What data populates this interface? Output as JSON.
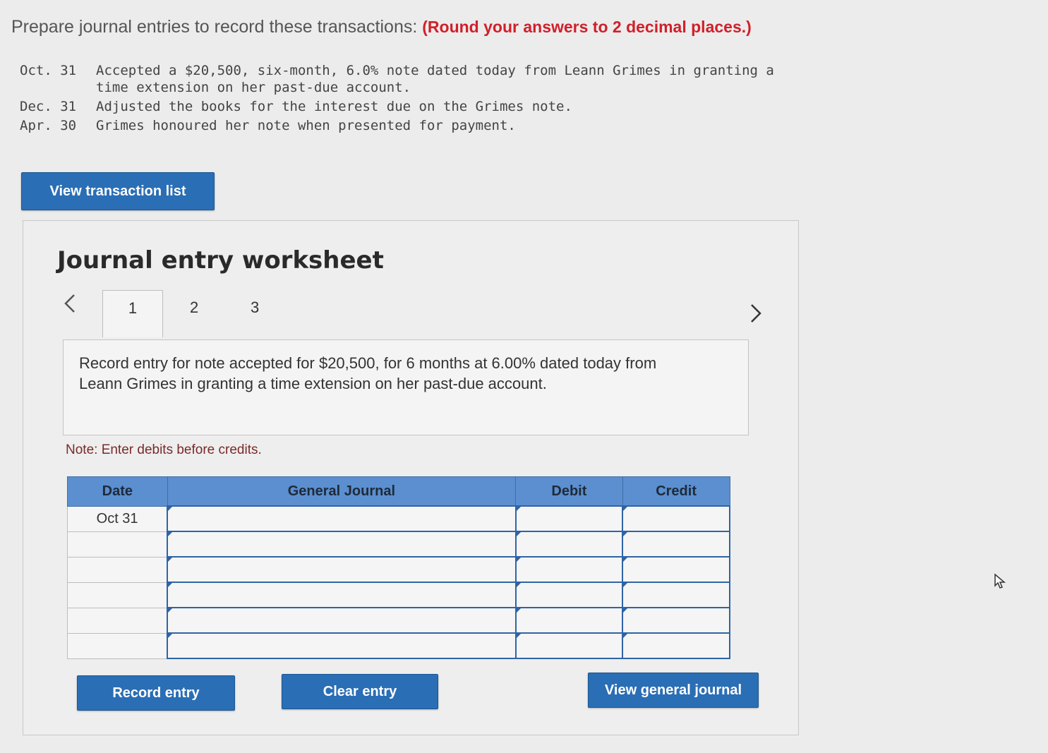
{
  "prompt": {
    "text": "Prepare journal entries to record these transactions: ",
    "emphasis": "(Round your answers to 2 decimal places.)"
  },
  "transactions": [
    {
      "date": "Oct. 31",
      "text": "Accepted a $20,500, six-month, 6.0% note dated today from Leann Grimes in granting a time extension on her past-due account."
    },
    {
      "date": "Dec. 31",
      "text": "Adjusted the books for the interest due on the Grimes note."
    },
    {
      "date": "Apr. 30",
      "text": "Grimes honoured her note when presented for payment."
    }
  ],
  "buttons": {
    "view_transactions": "View transaction list",
    "record": "Record entry",
    "clear": "Clear entry",
    "view_journal": "View general journal"
  },
  "worksheet": {
    "title": "Journal entry worksheet",
    "tabs": [
      "1",
      "2",
      "3"
    ],
    "prev_icon": "chevron-left-icon",
    "next_icon": "chevron-right-icon",
    "description": "Record entry for note accepted for $20,500, for 6 months at 6.00% dated today from Leann Grimes in granting a time extension on her past-due account.",
    "note": "Note: Enter debits before credits."
  },
  "table": {
    "headers": [
      "Date",
      "General Journal",
      "Debit",
      "Credit"
    ],
    "rows": [
      {
        "date": "Oct 31",
        "account": "",
        "debit": "",
        "credit": ""
      },
      {
        "date": "",
        "account": "",
        "debit": "",
        "credit": ""
      },
      {
        "date": "",
        "account": "",
        "debit": "",
        "credit": ""
      },
      {
        "date": "",
        "account": "",
        "debit": "",
        "credit": ""
      },
      {
        "date": "",
        "account": "",
        "debit": "",
        "credit": ""
      },
      {
        "date": "",
        "account": "",
        "debit": "",
        "credit": ""
      }
    ]
  },
  "colors": {
    "button_blue": "#2a6eb5",
    "header_blue": "#5b8fcf",
    "emphasis_red": "#d0202a"
  }
}
